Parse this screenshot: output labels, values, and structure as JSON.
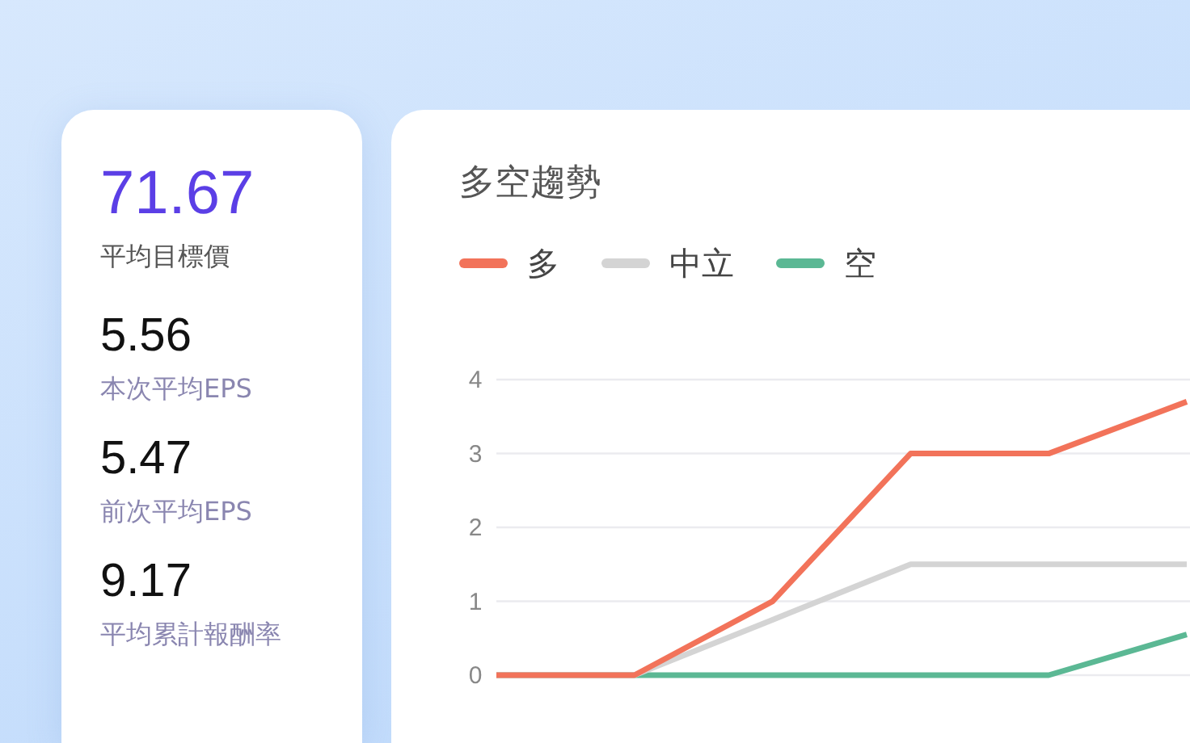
{
  "stats": [
    {
      "value": "71.67",
      "label": "平均目標價",
      "kind": "primary"
    },
    {
      "value": "5.56",
      "label": "本次平均EPS",
      "kind": "secondary"
    },
    {
      "value": "5.47",
      "label": "前次平均EPS",
      "kind": "secondary"
    },
    {
      "value": "9.17",
      "label": "平均累計報酬率",
      "kind": "secondary"
    }
  ],
  "trend": {
    "chart_data": {
      "type": "line",
      "title": "多空趨勢",
      "categories": [
        null,
        null,
        null,
        null,
        null,
        null
      ],
      "ylim": [
        0,
        4
      ],
      "grid": true,
      "yticks": [
        0,
        1,
        2,
        3,
        4
      ],
      "series": [
        {
          "name": "多",
          "color": "#f2735a",
          "values": [
            0,
            0,
            1,
            3,
            3,
            3.7
          ]
        },
        {
          "name": "中立",
          "color": "#d4d4d4",
          "values": [
            0,
            0,
            0.75,
            1.5,
            1.5,
            1.5
          ]
        },
        {
          "name": "空",
          "color": "#5bb894",
          "values": [
            0,
            0,
            0,
            0,
            0,
            0.55
          ]
        }
      ]
    }
  }
}
